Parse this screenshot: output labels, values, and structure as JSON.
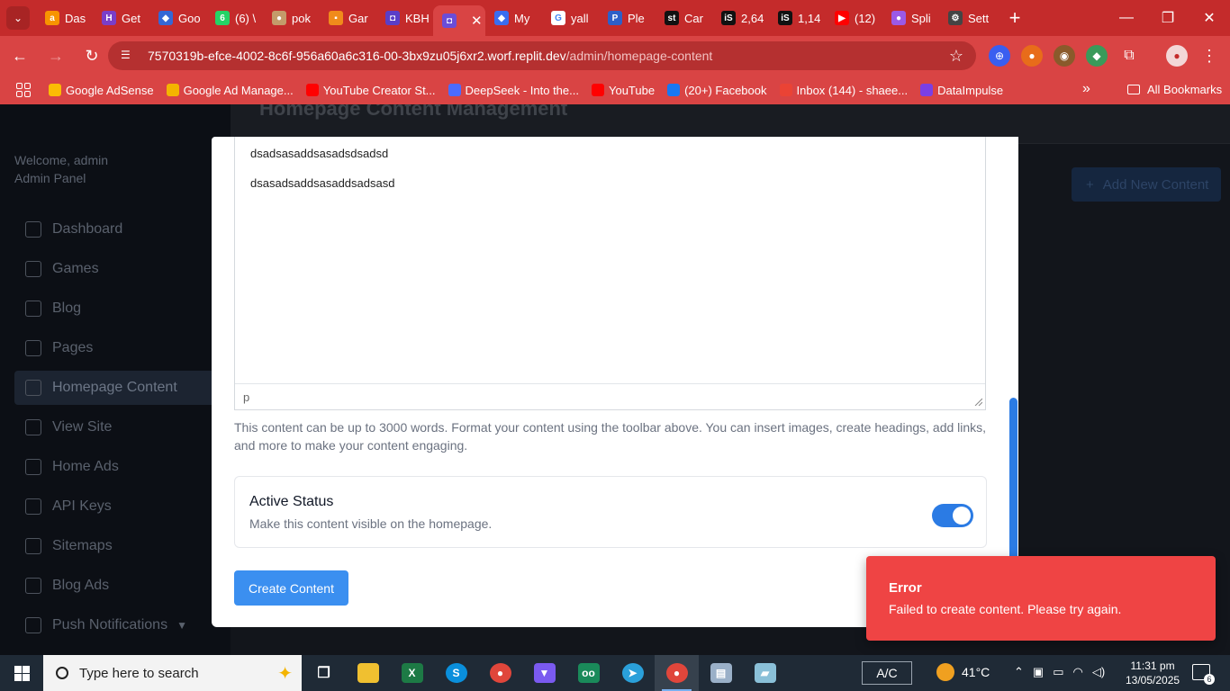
{
  "browser": {
    "tabs": [
      {
        "label": "Das",
        "color": "#f79400",
        "glyph": "a"
      },
      {
        "label": "Get",
        "color": "#7a3ec8",
        "glyph": "H"
      },
      {
        "label": "Goo",
        "color": "#3467d6",
        "glyph": "◆"
      },
      {
        "label": "(6) \\",
        "color": "#25d366",
        "glyph": "6"
      },
      {
        "label": "pok",
        "color": "#c49b6a",
        "glyph": "●"
      },
      {
        "label": "Gar",
        "color": "#f08b1b",
        "glyph": "▪"
      },
      {
        "label": "KBH",
        "color": "#5a3ec8",
        "glyph": "◘"
      },
      {
        "label": "",
        "color": "#6b4dd8",
        "glyph": "◘",
        "active": true
      },
      {
        "label": "My",
        "color": "#3a6df0",
        "glyph": "◆"
      },
      {
        "label": "yall",
        "color": "#ffffff",
        "glyph": "G"
      },
      {
        "label": "Ple",
        "color": "#2d5fc8",
        "glyph": "P"
      },
      {
        "label": "Car",
        "color": "#111111",
        "glyph": "st"
      },
      {
        "label": "2,64",
        "color": "#111111",
        "glyph": "iS"
      },
      {
        "label": "1,14",
        "color": "#111111",
        "glyph": "iS"
      },
      {
        "label": "(12)",
        "color": "#ff0000",
        "glyph": "▶"
      },
      {
        "label": "Spli",
        "color": "#9b59e6",
        "glyph": "●"
      },
      {
        "label": "Sett",
        "color": "#444444",
        "glyph": "⚙"
      }
    ],
    "url_host": "7570319b-efce-4002-8c6f-956a60a6c316-00-3bx9zu05j6xr2.worf.replit.dev",
    "url_path": "/admin/homepage-content",
    "bookmarks": [
      {
        "label": "Google AdSense",
        "color": "#fbbc04"
      },
      {
        "label": "Google Ad Manage...",
        "color": "#f4b400"
      },
      {
        "label": "YouTube Creator St...",
        "color": "#ff0000"
      },
      {
        "label": "DeepSeek - Into the...",
        "color": "#4d6bfe"
      },
      {
        "label": "YouTube",
        "color": "#ff0000"
      },
      {
        "label": "(20+) Facebook",
        "color": "#1877f2"
      },
      {
        "label": "Inbox (144) - shaee...",
        "color": "#ea4335"
      },
      {
        "label": "DataImpulse",
        "color": "#7b3fe4"
      }
    ],
    "all_bookmarks": "All Bookmarks"
  },
  "sidebar": {
    "welcome": "Welcome, admin",
    "role": "Admin Panel",
    "items": [
      {
        "label": "Dashboard"
      },
      {
        "label": "Games"
      },
      {
        "label": "Blog"
      },
      {
        "label": "Pages"
      },
      {
        "label": "Homepage Content",
        "active": true
      },
      {
        "label": "View Site"
      },
      {
        "label": "Home Ads"
      },
      {
        "label": "API Keys"
      },
      {
        "label": "Sitemaps"
      },
      {
        "label": "Blog Ads"
      },
      {
        "label": "Push Notifications"
      }
    ]
  },
  "main": {
    "title": "Homepage Content Management",
    "add_button": "Add New Content"
  },
  "modal": {
    "editor_lines": [
      "dsadsasaddsasadsdsadsd",
      "dsasadsaddsasaddsadsasd"
    ],
    "editor_status": "p",
    "help_text": "This content can be up to 3000 words. Format your content using the toolbar above. You can insert images, create headings, add links, and more to make your content engaging.",
    "status_title": "Active Status",
    "status_desc": "Make this content visible on the homepage.",
    "active": true,
    "create_button": "Create Content"
  },
  "toast": {
    "title": "Error",
    "message": "Failed to create content. Please try again.",
    "color": "#ef4444"
  },
  "taskbar": {
    "search_placeholder": "Type here to search",
    "ac_label": "A/C",
    "temperature": "41°C",
    "time": "11:31 pm",
    "date": "13/05/2025",
    "notification_count": "6"
  }
}
